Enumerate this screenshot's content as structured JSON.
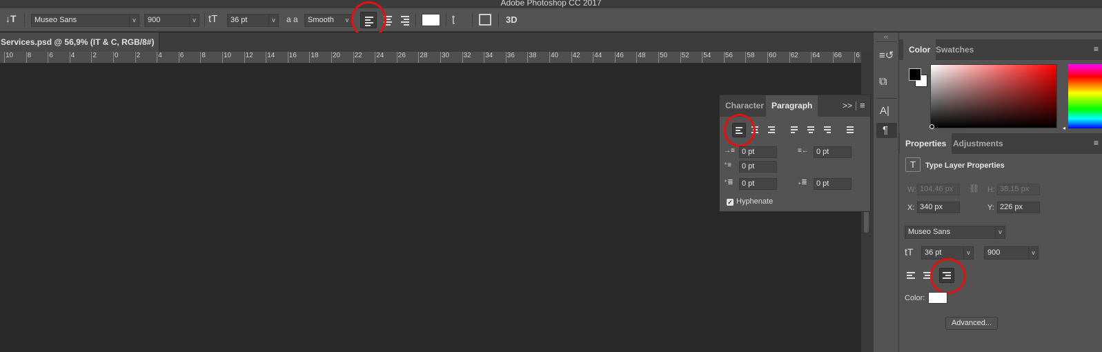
{
  "app": {
    "title": "Adobe Photoshop CC 2017"
  },
  "options_bar": {
    "font_family": "Museo Sans",
    "font_style": "900",
    "font_size": "36 pt",
    "antialias_glyph": "a a",
    "antialias": "Smooth",
    "three_d_label": "3D",
    "color_swatch": "#ffffff"
  },
  "document": {
    "tab_title": "Services.psd @ 56,9% (IT & C, RGB/8#) *"
  },
  "ruler": {
    "labels": [
      "10",
      "8",
      "6",
      "4",
      "2",
      "0",
      "2",
      "4",
      "6",
      "8",
      "10",
      "12",
      "14",
      "16",
      "18",
      "20",
      "22",
      "24",
      "26",
      "28",
      "30",
      "32",
      "34",
      "36",
      "38",
      "40",
      "42",
      "44",
      "46",
      "48",
      "50",
      "52",
      "54",
      "56",
      "58",
      "60",
      "62",
      "64",
      "66",
      "6"
    ]
  },
  "paragraph_panel": {
    "tabs": [
      "Character",
      "Paragraph"
    ],
    "active_tab": "Paragraph",
    "more_glyph": ">>",
    "menu_glyph": "≡",
    "indent_left": "0 pt",
    "indent_right": "0 pt",
    "indent_first_line": "0 pt",
    "space_before": "0 pt",
    "space_after": "0 pt",
    "hyphenate_label": "Hyphenate",
    "hyphenate_checked": true
  },
  "color_panel": {
    "tabs": [
      "Color",
      "Swatches"
    ],
    "active_tab": "Color",
    "foreground": "#000000",
    "background": "#ffffff"
  },
  "properties_panel": {
    "tabs": [
      "Properties",
      "Adjustments"
    ],
    "active_tab": "Properties",
    "heading": "Type Layer Properties",
    "w_label": "W:",
    "w_value": "104,46 px",
    "h_label": "H:",
    "h_value": "38,15 px",
    "x_label": "X:",
    "x_value": "340 px",
    "y_label": "Y:",
    "y_value": "226 px",
    "font_family": "Museo Sans",
    "font_size": "36 pt",
    "font_style": "900",
    "color_label": "Color:",
    "color_value": "#ffffff",
    "advanced_button": "Advanced..."
  },
  "icon_strip": {
    "items": [
      "history-icon",
      "layer-comps-icon",
      "character-icon",
      "paragraph-icon"
    ]
  },
  "highlight_color": "#e31212"
}
